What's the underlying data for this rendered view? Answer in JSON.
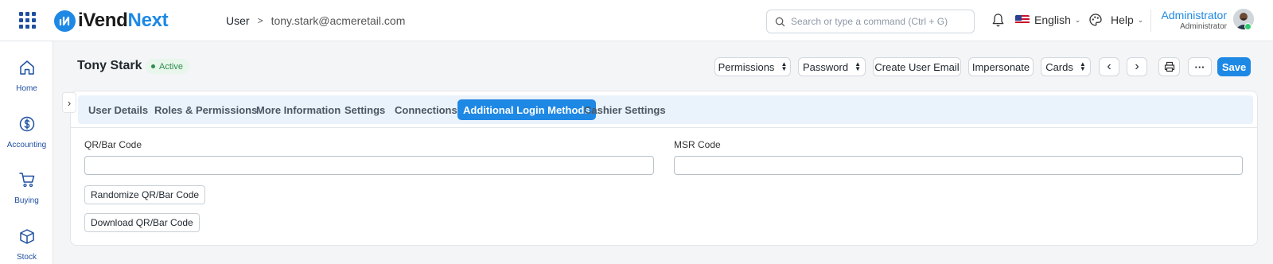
{
  "app": {
    "logo_text_a": "iVend",
    "logo_text_b": "Next"
  },
  "breadcrumb": {
    "parent": "User",
    "separator": ">",
    "current": "tony.stark@acmeretail.com"
  },
  "search": {
    "placeholder": "Search or type a command (Ctrl + G)"
  },
  "navbar": {
    "language": "English",
    "help": "Help",
    "user_name": "Administrator",
    "user_role": "Administrator"
  },
  "sidebar": {
    "items": [
      {
        "label": "Home",
        "icon": "home-icon"
      },
      {
        "label": "Accounting",
        "icon": "dollar-circle-icon"
      },
      {
        "label": "Buying",
        "icon": "cart-icon"
      },
      {
        "label": "Stock",
        "icon": "box-icon"
      }
    ]
  },
  "page": {
    "title": "Tony Stark",
    "status": "Active",
    "status_color": "#2e8c4e"
  },
  "actions": {
    "permissions": "Permissions",
    "password": "Password",
    "create_user_email": "Create User Email",
    "impersonate": "Impersonate",
    "cards": "Cards",
    "more": "···",
    "save": "Save",
    "prev": "‹",
    "next": "›"
  },
  "tabs": [
    {
      "label": "User Details",
      "active": false
    },
    {
      "label": "Roles & Permissions",
      "active": false
    },
    {
      "label": "More Information",
      "active": false
    },
    {
      "label": "Settings",
      "active": false
    },
    {
      "label": "Connections",
      "active": false
    },
    {
      "label": "Additional Login Methods",
      "active": true
    },
    {
      "label": "Cashier Settings",
      "active": false
    }
  ],
  "form": {
    "qr_label": "QR/Bar Code",
    "qr_value": "",
    "msr_label": "MSR Code",
    "msr_value": "",
    "randomize_button": "Randomize QR/Bar Code",
    "download_button": "Download QR/Bar Code"
  },
  "colors": {
    "accent": "#1e88e5",
    "nav_text": "#1f4fa0",
    "tab_bar": "#eaf2fb"
  }
}
